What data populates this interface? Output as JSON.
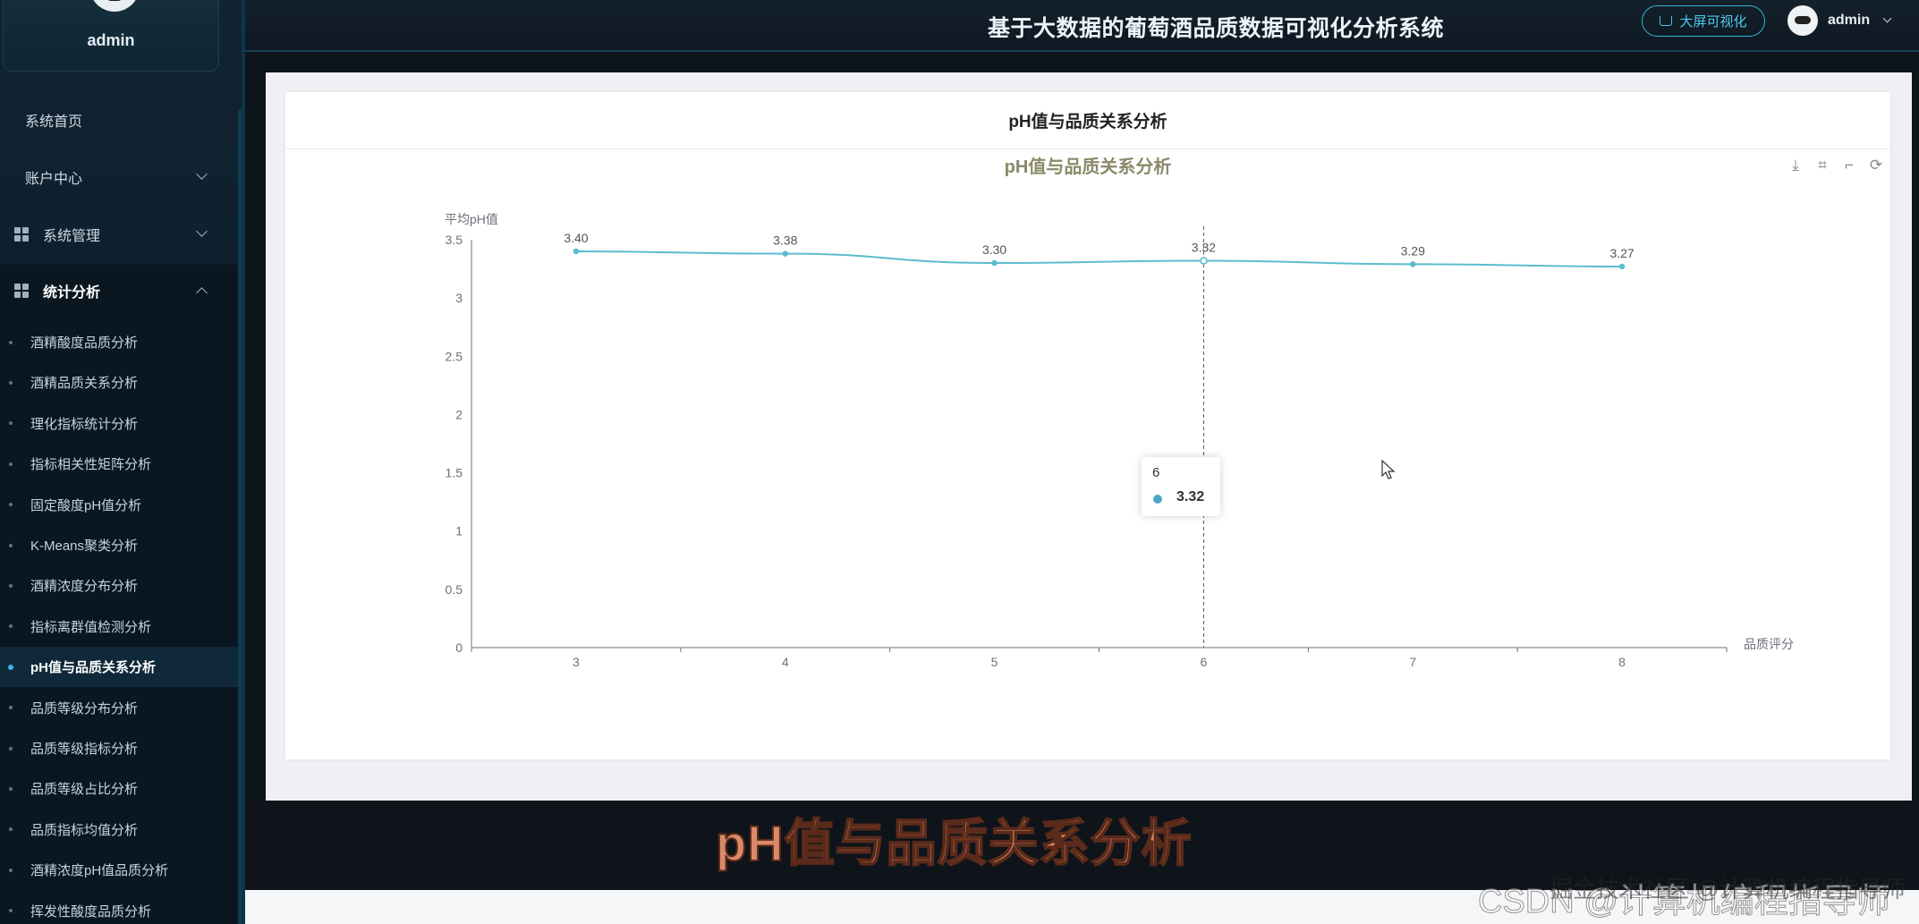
{
  "app": {
    "title": "基于大数据的葡萄酒品质数据可视化分析系统",
    "bigscreen_label": "大屏可视化",
    "user": "admin"
  },
  "sidebar": {
    "username": "admin",
    "items": [
      {
        "label": "系统首页"
      },
      {
        "label": "账户中心"
      },
      {
        "label": "系统管理"
      },
      {
        "label": "统计分析"
      }
    ],
    "sub_items": [
      {
        "label": "酒精酸度品质分析"
      },
      {
        "label": "酒精品质关系分析"
      },
      {
        "label": "理化指标统计分析"
      },
      {
        "label": "指标相关性矩阵分析"
      },
      {
        "label": "固定酸度pH值分析"
      },
      {
        "label": "K-Means聚类分析"
      },
      {
        "label": "酒精浓度分布分析"
      },
      {
        "label": "指标离群值检测分析"
      },
      {
        "label": "pH值与品质关系分析"
      },
      {
        "label": "品质等级分布分析"
      },
      {
        "label": "品质等级指标分析"
      },
      {
        "label": "品质等级占比分析"
      },
      {
        "label": "品质指标均值分析"
      },
      {
        "label": "酒精浓度pH值品质分析"
      },
      {
        "label": "挥发性酸度品质分析"
      }
    ],
    "active_index": 8
  },
  "card": {
    "header": "pH值与品质关系分析"
  },
  "tooltip": {
    "x": "6",
    "value": "3.32"
  },
  "chart_data": {
    "type": "line",
    "title": "pH值与品质关系分析",
    "xlabel": "品质评分",
    "ylabel": "平均pH值",
    "categories": [
      "3",
      "4",
      "5",
      "6",
      "7",
      "8"
    ],
    "values": [
      3.4,
      3.38,
      3.3,
      3.32,
      3.29,
      3.27
    ],
    "data_labels": [
      "3.40",
      "3.38",
      "3.30",
      "3.32",
      "3.29",
      "3.27"
    ],
    "ylim": [
      0,
      3.5
    ],
    "yticks": [
      "0",
      "0.5",
      "1",
      "1.5",
      "2",
      "2.5",
      "3",
      "3.5"
    ],
    "grid": false,
    "line_color": "#5bbcd0",
    "highlight_category": "6"
  },
  "caption": "pH值与品质关系分析",
  "watermark": "CSDN @计算机编程指导师",
  "watermark2": "掘金技术社区 @计算机编程指导师"
}
